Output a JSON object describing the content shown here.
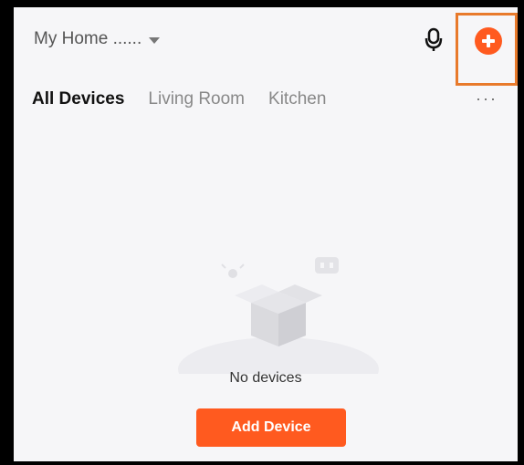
{
  "header": {
    "home_name": "My Home ......",
    "home_dropdown_icon": "caret-down-icon",
    "mic_icon": "microphone-icon",
    "add_icon": "plus-circle-icon",
    "accent_color": "#ff5a1f",
    "highlight_color": "#e87a2b"
  },
  "tabs": [
    {
      "label": "All Devices",
      "active": true
    },
    {
      "label": "Living Room",
      "active": false
    },
    {
      "label": "Kitchen",
      "active": false
    }
  ],
  "more_label": "···",
  "empty_state": {
    "message": "No devices",
    "button_label": "Add Device"
  }
}
